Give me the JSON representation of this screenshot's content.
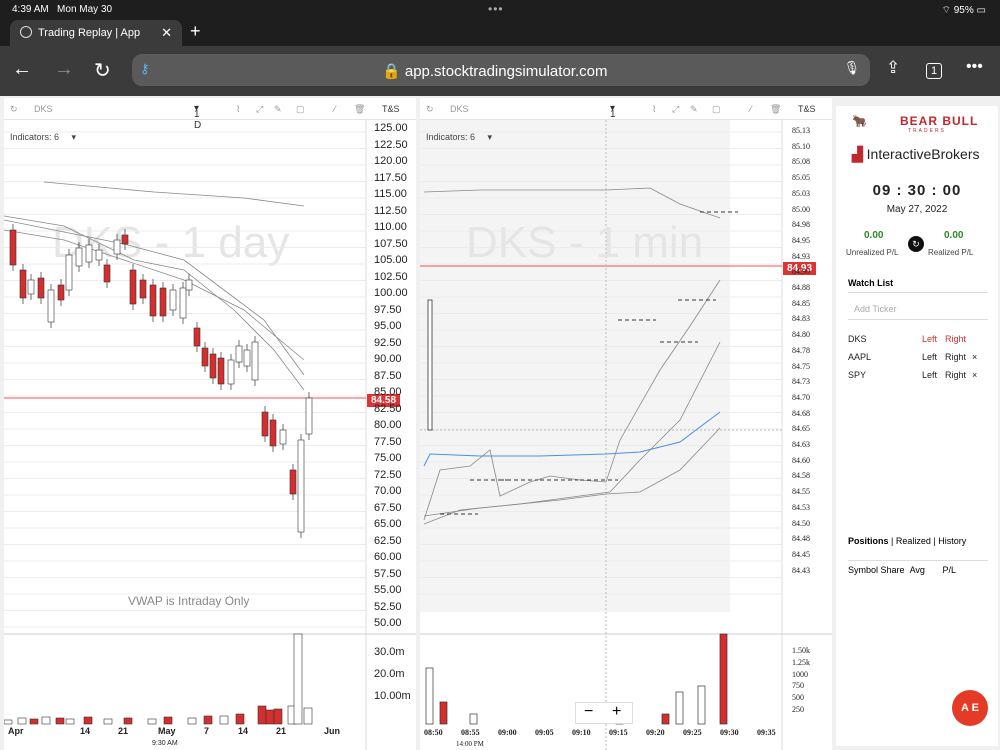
{
  "status": {
    "time": "4:39 AM",
    "date": "Mon May 30",
    "battery": "95%"
  },
  "browser": {
    "tab_title": "Trading Replay | App",
    "url": "app.stocktradingsimulator.com",
    "tabs_count": "1"
  },
  "daily": {
    "symbol": "DKS",
    "interval": "1 D",
    "ts": "T&S",
    "indicators": "Indicators: 6",
    "watermark": "DKS - 1 day",
    "vwap_note": "VWAP is Intraday Only",
    "price_tag": "84.58",
    "y_labels": [
      "125.00",
      "122.50",
      "120.00",
      "117.50",
      "115.00",
      "112.50",
      "110.00",
      "107.50",
      "105.00",
      "102.50",
      "100.00",
      "97.50",
      "95.00",
      "92.50",
      "90.00",
      "87.50",
      "85.00",
      "82.50",
      "80.00",
      "77.50",
      "75.00",
      "72.50",
      "70.00",
      "67.50",
      "65.00",
      "62.50",
      "60.00",
      "57.50",
      "55.00",
      "52.50",
      "50.00"
    ],
    "vol_labels": [
      "30.0m",
      "20.0m",
      "10.00m"
    ],
    "x_labels": [
      "Apr",
      "14",
      "21",
      "May",
      "7",
      "14",
      "21",
      "Jun"
    ],
    "x_sub": "9:30 AM"
  },
  "intraday": {
    "symbol": "DKS",
    "interval": "1 m",
    "ts": "T&S",
    "indicators": "Indicators: 6",
    "watermark": "DKS - 1 min",
    "price_tag": "84.93",
    "y_labels": [
      "85.13",
      "85.10",
      "85.08",
      "85.05",
      "85.03",
      "85.00",
      "84.98",
      "84.95",
      "84.93",
      "84.90",
      "84.88",
      "84.85",
      "84.83",
      "84.80",
      "84.78",
      "84.75",
      "84.73",
      "84.70",
      "84.68",
      "84.65",
      "84.63",
      "84.60",
      "84.58",
      "84.55",
      "84.53",
      "84.50",
      "84.48",
      "84.45",
      "84.43"
    ],
    "vol_labels": [
      "1.50k",
      "1.25k",
      "1000",
      "750",
      "500",
      "250"
    ],
    "x_labels": [
      "08:50",
      "08:55",
      "09:00",
      "09:05",
      "09:10",
      "09:15",
      "09:20",
      "09:25",
      "09:30",
      "09:35"
    ],
    "x_sub": "14:00 PM",
    "zoom_minus": "−",
    "zoom_plus": "+"
  },
  "sidebar": {
    "brand1": "BEAR BULL",
    "brand1_sub": "TRADERS",
    "brand2_a": "Interactive",
    "brand2_b": "Brokers",
    "clock": "09 : 30 : 00",
    "date": "May 27, 2022",
    "unrealized_value": "0.00",
    "unrealized_label": "Unrealized P/L",
    "realized_value": "0.00",
    "realized_label": "Realized P/L",
    "watchlist_title": "Watch List",
    "add_placeholder": "Add Ticker",
    "watchlist": [
      {
        "symbol": "DKS",
        "left": "Left",
        "right": "Right",
        "x": ""
      },
      {
        "symbol": "AAPL",
        "left": "Left",
        "right": "Right",
        "x": "×"
      },
      {
        "symbol": "SPY",
        "left": "Left",
        "right": "Right",
        "x": "×"
      }
    ],
    "tab_positions": "Positions",
    "tab_realized": "Realized",
    "tab_history": "History",
    "col_symbol": "Symbol",
    "col_share": "Share",
    "col_avg": "Avg",
    "col_pl": "P/L"
  },
  "fab": "A E",
  "colors": {
    "up": "#ffffff",
    "down": "#d32f2f",
    "price_line": "#e33",
    "vwap": "#4a90e2"
  }
}
